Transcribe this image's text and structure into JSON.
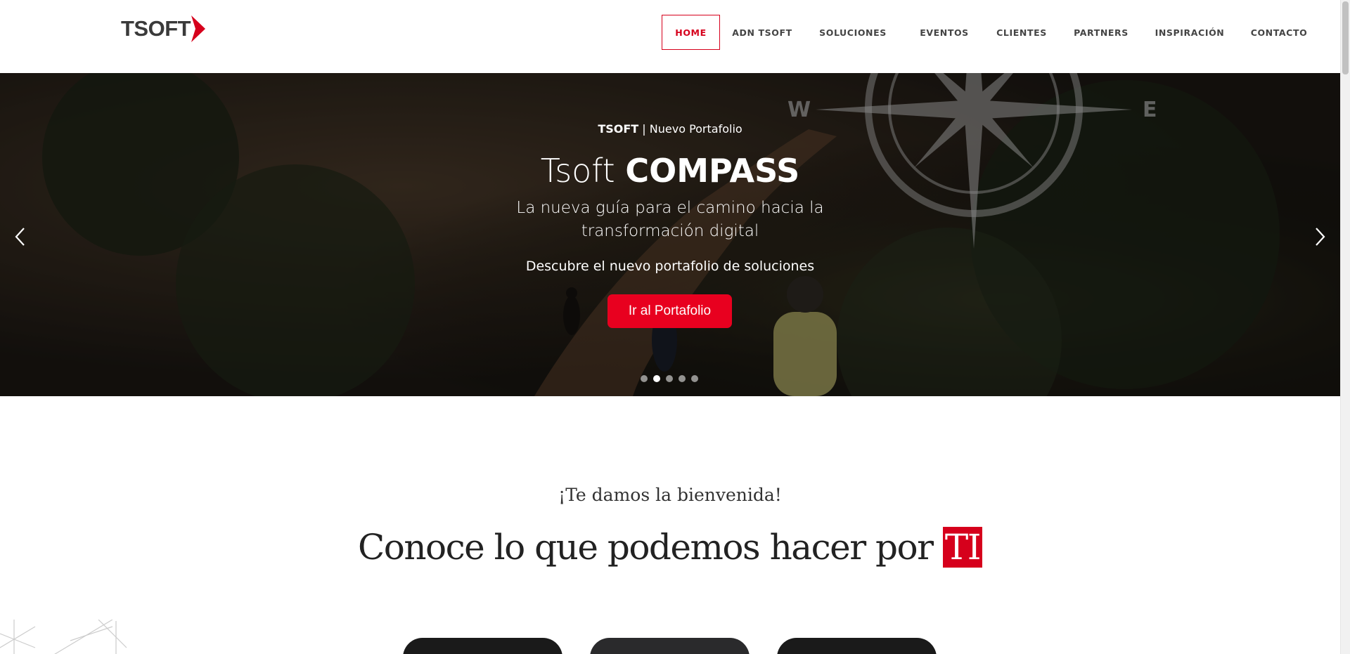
{
  "brand": {
    "logo_text": "TSOFT",
    "accent": "#d6001c"
  },
  "nav": {
    "items": [
      {
        "label": "HOME",
        "active": true
      },
      {
        "label": "ADN TSOFT"
      },
      {
        "label": "SOLUCIONES"
      },
      {
        "label": "EVENTOS"
      },
      {
        "label": "CLIENTES"
      },
      {
        "label": "PARTNERS"
      },
      {
        "label": "INSPIRACIÓN"
      },
      {
        "label": "CONTACTO"
      }
    ]
  },
  "hero": {
    "eyebrow_bold": "TSOFT",
    "eyebrow_rest": " | Nuevo Portafolio",
    "title_light": "Tsoft ",
    "title_bold": "COMPASS",
    "subtitle": "La nueva guía para el camino hacia la transformación digital",
    "description": "Descubre el nuevo portafolio de soluciones",
    "button_label": "Ir al Portafolio",
    "compass_w": "W",
    "compass_e": "E",
    "slides": 5,
    "active_slide": 2,
    "button_color": "#e8001f"
  },
  "welcome": {
    "kicker": "¡Te damos la bienvenida!",
    "headline": "Conoce lo que podemos hacer por ",
    "headline_highlight": "TI"
  }
}
